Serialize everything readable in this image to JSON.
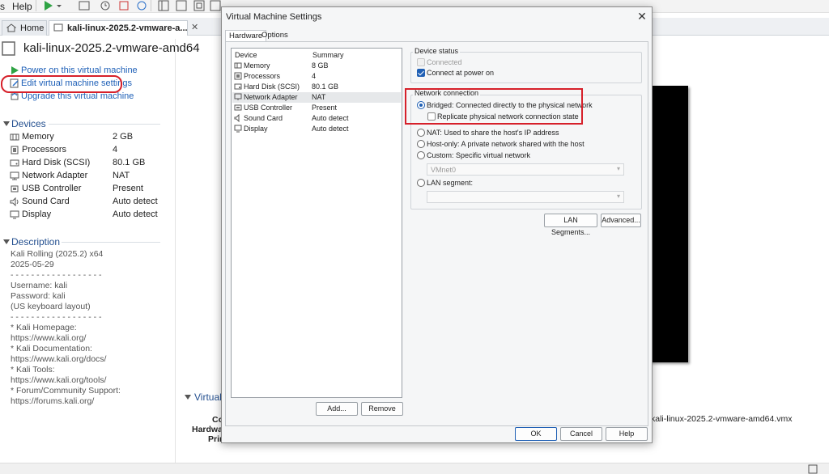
{
  "menubar": {
    "partial_menu": "s",
    "help": "Help"
  },
  "tabs": [
    {
      "label": "Home"
    },
    {
      "label": "kali-linux-2025.2-vmware-a..."
    }
  ],
  "vm": {
    "title": "kali-linux-2025.2-vmware-amd64",
    "commands": {
      "power_on": "Power on this virtual machine",
      "edit_settings": "Edit virtual machine settings",
      "upgrade": "Upgrade this virtual machine"
    },
    "devices_heading": "Devices",
    "devices": [
      {
        "name": "Memory",
        "value": "2 GB",
        "icon": "memory-icon"
      },
      {
        "name": "Processors",
        "value": "4",
        "icon": "processor-icon"
      },
      {
        "name": "Hard Disk (SCSI)",
        "value": "80.1 GB",
        "icon": "hard-disk-icon"
      },
      {
        "name": "Network Adapter",
        "value": "NAT",
        "icon": "network-adapter-icon"
      },
      {
        "name": "USB Controller",
        "value": "Present",
        "icon": "usb-icon"
      },
      {
        "name": "Sound Card",
        "value": "Auto detect",
        "icon": "sound-card-icon"
      },
      {
        "name": "Display",
        "value": "Auto detect",
        "icon": "display-icon"
      }
    ],
    "description_heading": "Description",
    "description_lines": [
      "Kali Rolling (2025.2) x64",
      "2025-05-29",
      "",
      "- - - - - - - - - - - - - - - - - -",
      "",
      "Username: kali",
      "Password: kali",
      "(US keyboard layout)",
      "",
      "- - - - - - - - - - - - - - - - - -",
      "",
      "* Kali Homepage:",
      "https://www.kali.org/",
      "",
      "* Kali Documentation:",
      "https://www.kali.org/docs/",
      "",
      "* Kali Tools:",
      "https://www.kali.org/tools/",
      "",
      "* Forum/Community Support:",
      "https://forums.kali.org/"
    ],
    "details_heading": "Virtual",
    "details_labels": [
      "Co",
      "Hardwa",
      "Prin"
    ],
    "vmx_path": "kali-linux-2025.2-vmware-amd64.vmx"
  },
  "dialog": {
    "title": "Virtual Machine Settings",
    "close": "✕",
    "tabs": [
      "Hardware",
      "Options"
    ],
    "list_headers": {
      "device": "Device",
      "summary": "Summary"
    },
    "devices": [
      {
        "name": "Memory",
        "value": "8 GB",
        "icon": "memory-icon"
      },
      {
        "name": "Processors",
        "value": "4",
        "icon": "processor-icon"
      },
      {
        "name": "Hard Disk (SCSI)",
        "value": "80.1 GB",
        "icon": "hard-disk-icon"
      },
      {
        "name": "Network Adapter",
        "value": "NAT",
        "icon": "network-adapter-icon"
      },
      {
        "name": "USB Controller",
        "value": "Present",
        "icon": "usb-icon"
      },
      {
        "name": "Sound Card",
        "value": "Auto detect",
        "icon": "sound-card-icon"
      },
      {
        "name": "Display",
        "value": "Auto detect",
        "icon": "display-icon"
      }
    ],
    "add_button": "Add...",
    "remove_button": "Remove",
    "device_status": {
      "label": "Device status",
      "connected": "Connected",
      "connect_at_power_on": "Connect at power on"
    },
    "network": {
      "label": "Network connection",
      "bridged": "Bridged: Connected directly to the physical network",
      "replicate": "Replicate physical network connection state",
      "nat": "NAT: Used to share the host's IP address",
      "host_only": "Host-only: A private network shared with the host",
      "custom": "Custom: Specific virtual network",
      "vmnet": "VMnet0",
      "lan_segment": "LAN segment:",
      "lan_segment_value": ""
    },
    "lan_segments_button": "LAN Segments...",
    "advanced_button": "Advanced...",
    "ok": "OK",
    "cancel": "Cancel",
    "help": "Help"
  },
  "colors": {
    "accent": "#1f5fb4",
    "link": "#1d5fb7",
    "highlight": "#d6202a",
    "heading": "#234f8f"
  }
}
